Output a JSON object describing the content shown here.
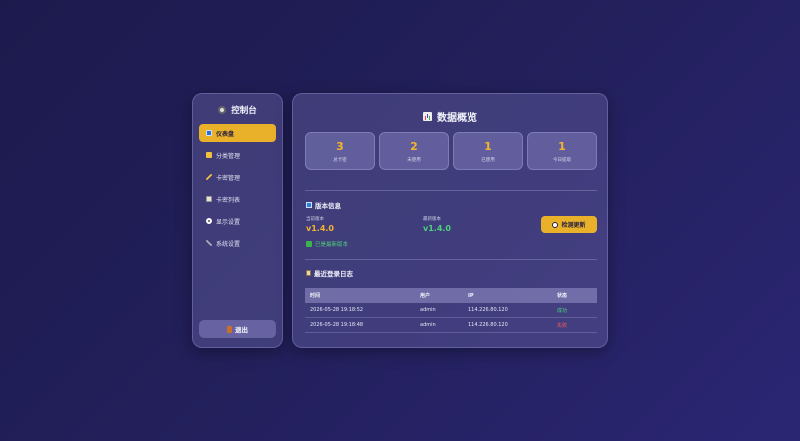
{
  "sidebar": {
    "title": "控制台",
    "items": [
      {
        "label": "仪表盘",
        "icon": "dashboard-icon",
        "active": true
      },
      {
        "label": "分类管理",
        "icon": "folder-icon",
        "active": false
      },
      {
        "label": "卡密管理",
        "icon": "pencil-icon",
        "active": false
      },
      {
        "label": "卡密列表",
        "icon": "list-icon",
        "active": false
      },
      {
        "label": "显示设置",
        "icon": "eye-icon",
        "active": false
      },
      {
        "label": "系统设置",
        "icon": "wrench-icon",
        "active": false
      }
    ],
    "logout_label": "退出"
  },
  "main": {
    "title": "数据概览",
    "stats": [
      {
        "value": "3",
        "label": "总卡密"
      },
      {
        "value": "2",
        "label": "未使用"
      },
      {
        "value": "1",
        "label": "已使用"
      },
      {
        "value": "1",
        "label": "今日提取"
      }
    ],
    "version": {
      "heading": "版本信息",
      "current_label": "当前版本",
      "current_value": "v1.4.0",
      "latest_label": "最新版本",
      "latest_value": "v1.4.0",
      "status_note": "已是最新版本",
      "check_button": "检测更新"
    },
    "login_log": {
      "heading": "最近登录日志",
      "columns": [
        "时间",
        "用户",
        "IP",
        "状态"
      ],
      "rows": [
        {
          "time": "2026-05-28 19:18:52",
          "user": "admin",
          "ip": "114.226.80.120",
          "status": "成功"
        },
        {
          "time": "2026-05-28 19:18:48",
          "user": "admin",
          "ip": "114.226.80.120",
          "status": "失败"
        }
      ]
    }
  },
  "colors": {
    "accent": "#e9b12a",
    "stat_value": "#f3b52e",
    "current_version": "#f3b52e",
    "latest_version": "#4cd07a",
    "success": "#4cd07a",
    "fail": "#ff5a5a"
  }
}
